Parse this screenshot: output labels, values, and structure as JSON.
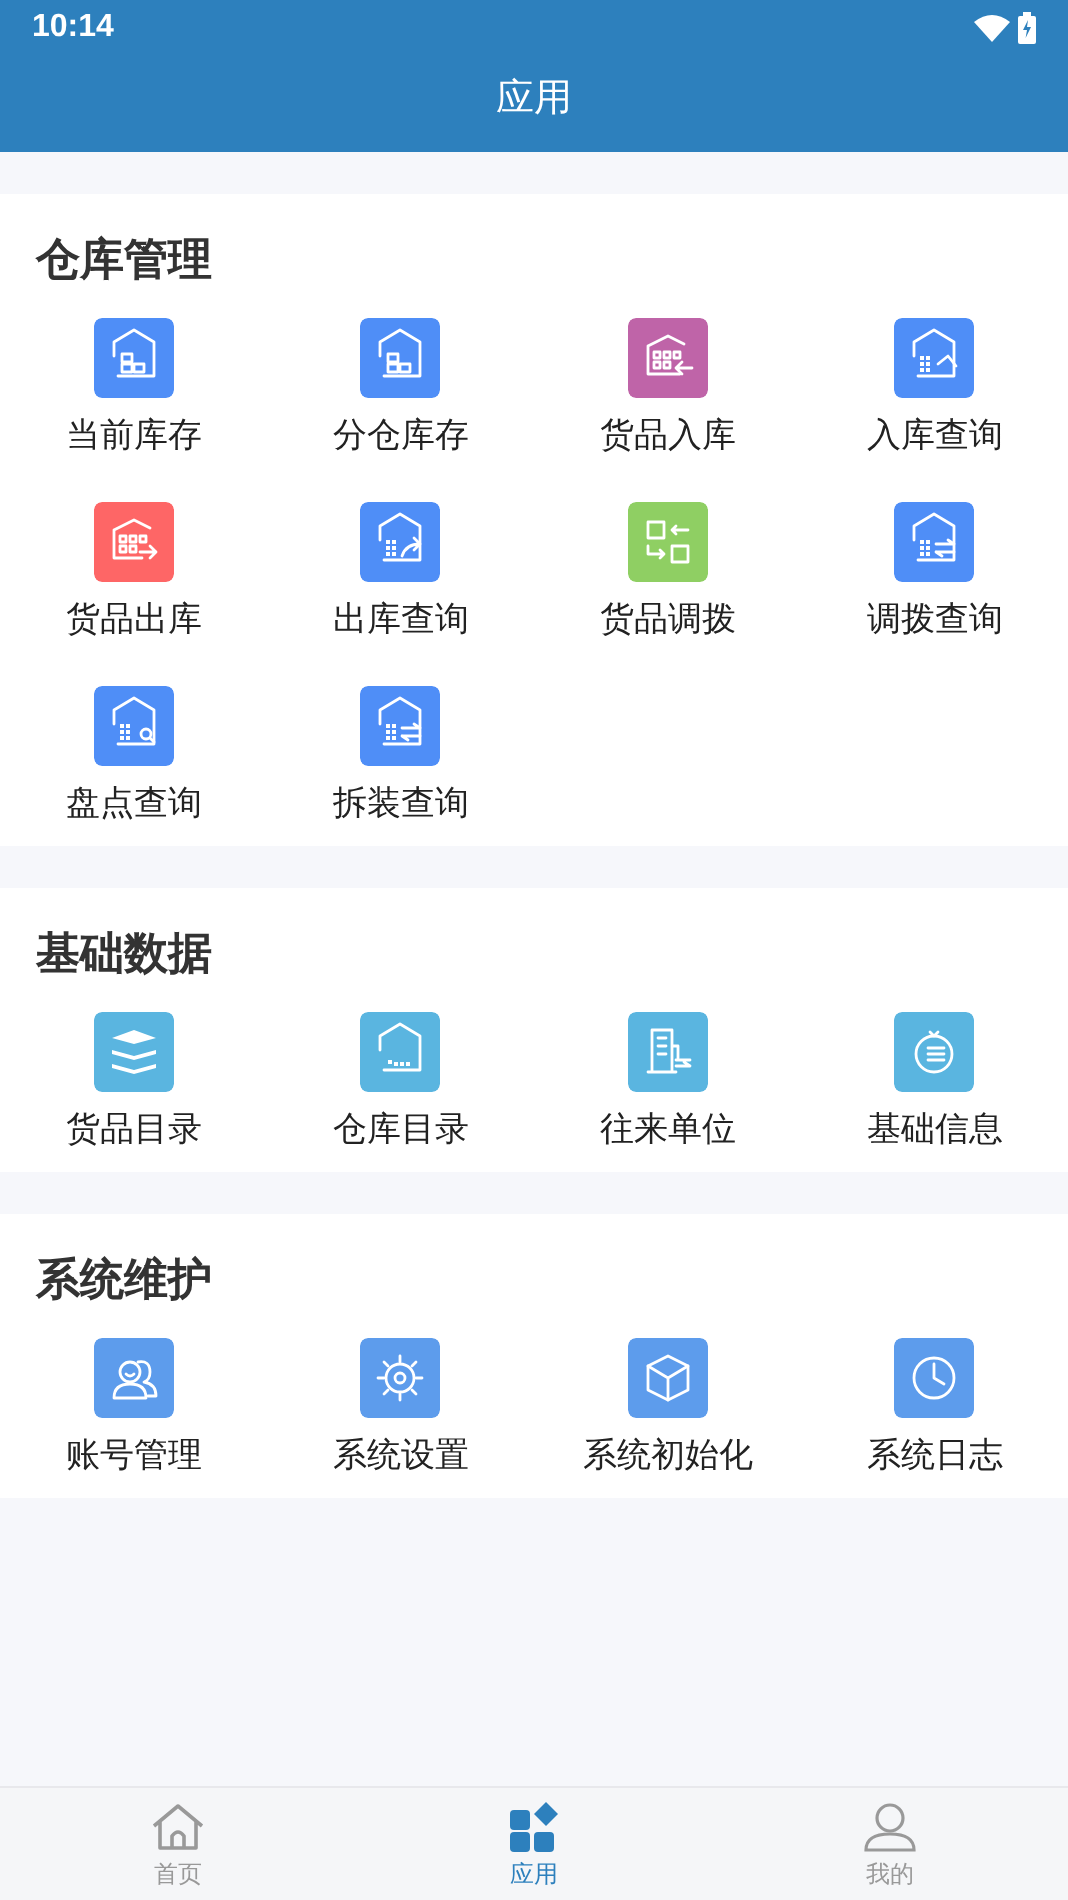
{
  "status_bar": {
    "time": "10:14"
  },
  "header": {
    "title": "应用"
  },
  "sections": [
    {
      "title": "仓库管理",
      "items": [
        {
          "label": "当前库存",
          "color": "#4f8ef7"
        },
        {
          "label": "分仓库存",
          "color": "#4f8ef7"
        },
        {
          "label": "货品入库",
          "color": "#bf64a8"
        },
        {
          "label": "入库查询",
          "color": "#4f8ef7"
        },
        {
          "label": "货品出库",
          "color": "#fe6666"
        },
        {
          "label": "出库查询",
          "color": "#4f8ef7"
        },
        {
          "label": "货品调拨",
          "color": "#8fcf63"
        },
        {
          "label": "调拨查询",
          "color": "#4f8ef7"
        },
        {
          "label": "盘点查询",
          "color": "#4f8ef7"
        },
        {
          "label": "拆装查询",
          "color": "#4f8ef7"
        }
      ]
    },
    {
      "title": "基础数据",
      "items": [
        {
          "label": "货品目录",
          "color": "#5ab5e0"
        },
        {
          "label": "仓库目录",
          "color": "#5ab5e0"
        },
        {
          "label": "往来单位",
          "color": "#5ab5e0"
        },
        {
          "label": "基础信息",
          "color": "#5ab5e0"
        }
      ]
    },
    {
      "title": "系统维护",
      "items": [
        {
          "label": "账号管理",
          "color": "#5d9cec"
        },
        {
          "label": "系统设置",
          "color": "#5d9cec"
        },
        {
          "label": "系统初始化",
          "color": "#5d9cec"
        },
        {
          "label": "系统日志",
          "color": "#5d9cec"
        }
      ]
    }
  ],
  "bottom_nav": [
    {
      "label": "首页",
      "selected": false
    },
    {
      "label": "应用",
      "selected": true
    },
    {
      "label": "我的",
      "selected": false
    }
  ]
}
